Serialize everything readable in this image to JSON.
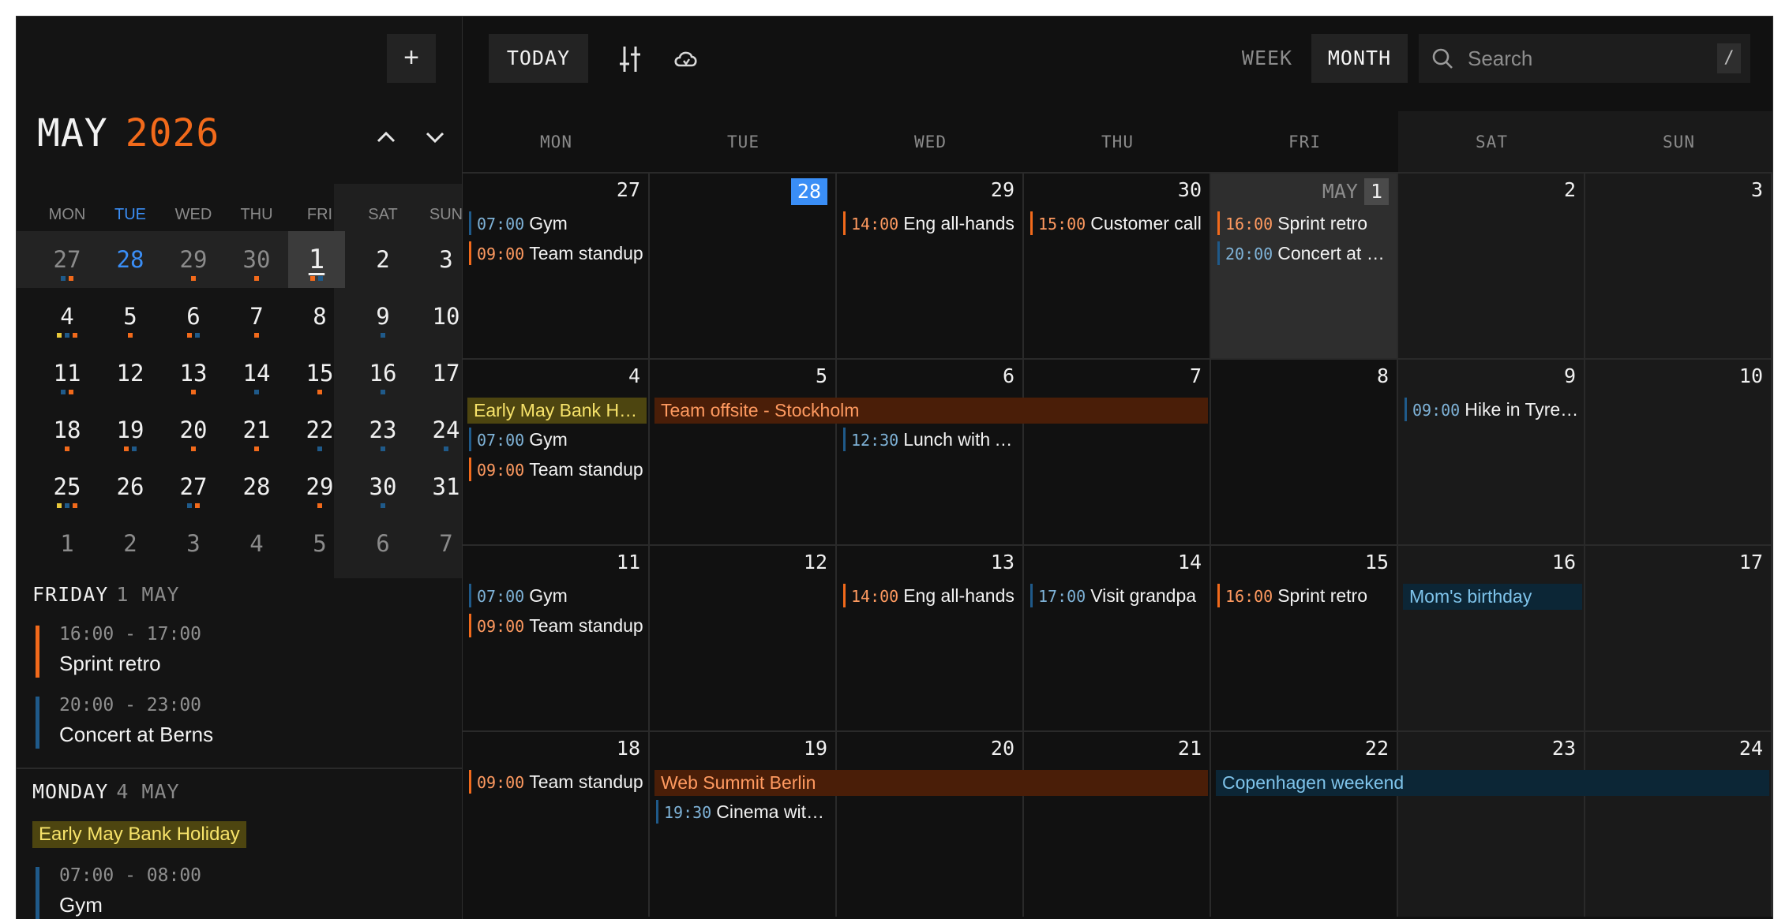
{
  "colors": {
    "accent_orange": "#f26a1b",
    "blue_event": "#1f5a8a",
    "today_blue": "#3a8ef6",
    "holiday_bg": "#4d4510",
    "holiday_text": "#f7e36a",
    "orange_span_bg": "#4a1e08",
    "orange_span_text": "#ff9a60",
    "blue_span_bg": "#0c2636",
    "blue_span_text": "#7ec3ea"
  },
  "sidebar": {
    "new_label": "+",
    "month": "MAY",
    "year": "2026",
    "weekdays": [
      "MON",
      "TUE",
      "WED",
      "THU",
      "FRI",
      "SAT",
      "SUN"
    ],
    "weeks": [
      [
        {
          "d": "27",
          "dim": true,
          "dots": [
            "b",
            "o"
          ]
        },
        {
          "d": "28",
          "dim": false,
          "today": true,
          "dots": []
        },
        {
          "d": "29",
          "dim": true,
          "dots": [
            "o"
          ]
        },
        {
          "d": "30",
          "dim": true,
          "dots": [
            "o"
          ]
        },
        {
          "d": "1",
          "sel": true,
          "dots": [
            "o",
            "b"
          ]
        },
        {
          "d": "2",
          "dots": []
        },
        {
          "d": "3",
          "dots": []
        }
      ],
      [
        {
          "d": "4",
          "dots": [
            "y",
            "b",
            "o"
          ]
        },
        {
          "d": "5",
          "dots": [
            "o"
          ]
        },
        {
          "d": "6",
          "dots": [
            "o",
            "b"
          ]
        },
        {
          "d": "7",
          "dots": [
            "o"
          ]
        },
        {
          "d": "8",
          "dots": []
        },
        {
          "d": "9",
          "dots": [
            "b"
          ]
        },
        {
          "d": "10",
          "dots": []
        }
      ],
      [
        {
          "d": "11",
          "dots": [
            "b",
            "o"
          ]
        },
        {
          "d": "12",
          "dots": []
        },
        {
          "d": "13",
          "dots": [
            "o"
          ]
        },
        {
          "d": "14",
          "dots": [
            "b"
          ]
        },
        {
          "d": "15",
          "dots": [
            "o"
          ]
        },
        {
          "d": "16",
          "dots": [
            "b"
          ]
        },
        {
          "d": "17",
          "dots": []
        }
      ],
      [
        {
          "d": "18",
          "dots": [
            "o"
          ]
        },
        {
          "d": "19",
          "dots": [
            "o",
            "b"
          ]
        },
        {
          "d": "20",
          "dots": [
            "o"
          ]
        },
        {
          "d": "21",
          "dots": [
            "o"
          ]
        },
        {
          "d": "22",
          "dots": [
            "b"
          ]
        },
        {
          "d": "23",
          "dots": [
            "b"
          ]
        },
        {
          "d": "24",
          "dots": [
            "b"
          ]
        }
      ],
      [
        {
          "d": "25",
          "dots": [
            "y",
            "b",
            "o"
          ]
        },
        {
          "d": "26",
          "dots": []
        },
        {
          "d": "27",
          "dots": [
            "b",
            "o"
          ]
        },
        {
          "d": "28",
          "dots": []
        },
        {
          "d": "29",
          "dots": [
            "o"
          ]
        },
        {
          "d": "30",
          "dots": [
            "b"
          ]
        },
        {
          "d": "31",
          "dots": []
        }
      ],
      [
        {
          "d": "1",
          "dim": true,
          "dots": []
        },
        {
          "d": "2",
          "dim": true,
          "dots": []
        },
        {
          "d": "3",
          "dim": true,
          "dots": []
        },
        {
          "d": "4",
          "dim": true,
          "dots": []
        },
        {
          "d": "5",
          "dim": true,
          "dots": []
        },
        {
          "d": "6",
          "dim": true,
          "dots": []
        },
        {
          "d": "7",
          "dim": true,
          "dots": []
        }
      ]
    ],
    "agenda": [
      {
        "day": "FRIDAY",
        "date": "1 MAY",
        "events": [
          {
            "time": "16:00 - 17:00",
            "name": "Sprint retro",
            "color": "o"
          },
          {
            "time": "20:00 - 23:00",
            "name": "Concert at Berns",
            "color": "b"
          }
        ]
      },
      {
        "day": "MONDAY",
        "date": "4 MAY",
        "holiday": "Early May Bank Holiday",
        "events": [
          {
            "time": "07:00 - 08:00",
            "name": "Gym",
            "color": "b"
          }
        ]
      }
    ]
  },
  "toolbar": {
    "today_label": "TODAY",
    "week_label": "WEEK",
    "month_label": "MONTH",
    "search_placeholder": "Search",
    "search_shortcut": "/"
  },
  "month_grid": {
    "weekdays": [
      "MON",
      "TUE",
      "WED",
      "THU",
      "FRI",
      "SAT",
      "SUN"
    ],
    "weeks": [
      [
        {
          "d": "27",
          "events": [
            {
              "t": "07:00",
              "n": "Gym",
              "c": "b"
            },
            {
              "t": "09:00",
              "n": "Team standup",
              "c": "o"
            }
          ]
        },
        {
          "d": "28",
          "today": true,
          "events": []
        },
        {
          "d": "29",
          "events": [
            {
              "t": "14:00",
              "n": "Eng all-hands",
              "c": "o"
            }
          ]
        },
        {
          "d": "30",
          "events": [
            {
              "t": "15:00",
              "n": "Customer call",
              "c": "o"
            }
          ]
        },
        {
          "d": "1",
          "month": "MAY",
          "sel": true,
          "events": [
            {
              "t": "16:00",
              "n": "Sprint retro",
              "c": "o"
            },
            {
              "t": "20:00",
              "n": "Concert at Berns",
              "c": "b"
            }
          ]
        },
        {
          "d": "2",
          "events": []
        },
        {
          "d": "3",
          "events": []
        }
      ],
      [
        {
          "d": "4",
          "events": [
            {
              "t": "07:00",
              "n": "Gym",
              "c": "b",
              "row": 1
            },
            {
              "t": "09:00",
              "n": "Team standup",
              "c": "o",
              "row": 2
            }
          ]
        },
        {
          "d": "5",
          "events": []
        },
        {
          "d": "6",
          "events": [
            {
              "t": "12:30",
              "n": "Lunch with Anna",
              "c": "b",
              "row": 1
            }
          ]
        },
        {
          "d": "7",
          "events": []
        },
        {
          "d": "8",
          "events": []
        },
        {
          "d": "9",
          "events": [
            {
              "t": "09:00",
              "n": "Hike in Tyresta",
              "c": "b"
            }
          ]
        },
        {
          "d": "10",
          "events": []
        }
      ],
      [
        {
          "d": "11",
          "events": [
            {
              "t": "07:00",
              "n": "Gym",
              "c": "b"
            },
            {
              "t": "09:00",
              "n": "Team standup",
              "c": "o"
            }
          ]
        },
        {
          "d": "12",
          "events": []
        },
        {
          "d": "13",
          "events": [
            {
              "t": "14:00",
              "n": "Eng all-hands",
              "c": "o"
            }
          ]
        },
        {
          "d": "14",
          "events": [
            {
              "t": "17:00",
              "n": "Visit grandpa",
              "c": "b"
            }
          ]
        },
        {
          "d": "15",
          "events": [
            {
              "t": "16:00",
              "n": "Sprint retro",
              "c": "o"
            }
          ]
        },
        {
          "d": "16",
          "events": []
        },
        {
          "d": "17",
          "events": []
        }
      ],
      [
        {
          "d": "18",
          "events": [
            {
              "t": "09:00",
              "n": "Team standup",
              "c": "o"
            }
          ]
        },
        {
          "d": "19",
          "events": [
            {
              "t": "19:30",
              "n": "Cinema with Leo",
              "c": "b",
              "row": 1
            }
          ]
        },
        {
          "d": "20",
          "events": []
        },
        {
          "d": "21",
          "events": []
        },
        {
          "d": "22",
          "events": []
        },
        {
          "d": "23",
          "events": []
        },
        {
          "d": "24",
          "events": []
        }
      ]
    ],
    "spans": [
      {
        "week": 1,
        "start": 0,
        "len": 1,
        "n": "Early May Bank Holiday",
        "kind": "holiday"
      },
      {
        "week": 1,
        "start": 1,
        "len": 3,
        "n": "Team offsite - Stockholm",
        "kind": "orange"
      },
      {
        "week": 2,
        "start": 5,
        "len": 1,
        "n": "Mom's birthday",
        "kind": "blue"
      },
      {
        "week": 3,
        "start": 1,
        "len": 3,
        "n": "Web Summit Berlin",
        "kind": "orange"
      },
      {
        "week": 3,
        "start": 4,
        "len": 3,
        "n": "Copenhagen weekend",
        "kind": "blue"
      }
    ]
  }
}
